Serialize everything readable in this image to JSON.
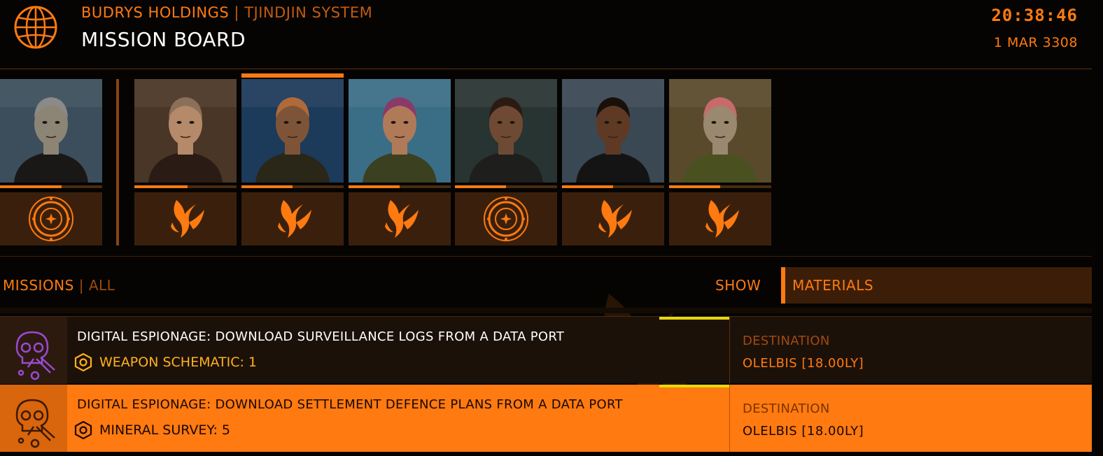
{
  "header": {
    "organisation": "BUDRYS HOLDINGS",
    "separator": "|",
    "system": "TJINDJIN SYSTEM",
    "title": "MISSION BOARD",
    "time": "20:38:46",
    "date": "1 MAR 3308"
  },
  "contacts": [
    {
      "faction_icon": "federation-emblem-icon",
      "reputation": 0.6,
      "selected": false,
      "skin": "#8c8474",
      "hair": "#8a8a88",
      "bg": "#3c4e5c",
      "coat": "#1a1816"
    },
    {
      "faction_icon": "phoenix-emblem-icon",
      "reputation": 0.52,
      "selected": false,
      "skin": "#b48a6a",
      "hair": "#8a7058",
      "bg": "#4a3626",
      "coat": "#2a1c14"
    },
    {
      "faction_icon": "phoenix-emblem-icon",
      "reputation": 0.5,
      "selected": true,
      "skin": "#7e5438",
      "hair": "#b06a3a",
      "bg": "#1c3a5a",
      "coat": "#2a2618"
    },
    {
      "faction_icon": "phoenix-emblem-icon",
      "reputation": 0.5,
      "selected": false,
      "skin": "#b07a58",
      "hair": "#8a3a6a",
      "bg": "#3a6e86",
      "coat": "#3a4020"
    },
    {
      "faction_icon": "federation-emblem-icon",
      "reputation": 0.5,
      "selected": false,
      "skin": "#6e4a34",
      "hair": "#2a1a12",
      "bg": "#283432",
      "coat": "#1e1e1c"
    },
    {
      "faction_icon": "phoenix-emblem-icon",
      "reputation": 0.5,
      "selected": false,
      "skin": "#5e3a24",
      "hair": "#1a100a",
      "bg": "#3a4854",
      "coat": "#141414"
    },
    {
      "faction_icon": "phoenix-emblem-icon",
      "reputation": 0.5,
      "selected": false,
      "skin": "#9a8870",
      "hair": "#c86a6a",
      "bg": "#5a4a2c",
      "coat": "#4a5020"
    }
  ],
  "filter": {
    "missions_label": "MISSIONS",
    "separator": "|",
    "scope": "ALL",
    "show_label": "SHOW",
    "show_value": "MATERIALS"
  },
  "missions": [
    {
      "title": "DIGITAL ESPIONAGE: DOWNLOAD SURVEILLANCE LOGS FROM A DATA PORT",
      "reward": "WEAPON SCHEMATIC: 1",
      "destination_label": "DESTINATION",
      "destination": "OLELBIS [18.00LY]",
      "icon": "skull-hacking-icon"
    },
    {
      "title": "DIGITAL ESPIONAGE: DOWNLOAD SETTLEMENT DEFENCE PLANS FROM A DATA PORT",
      "reward": "MINERAL SURVEY: 5",
      "destination_label": "DESTINATION",
      "destination": "OLELBIS [18.00LY]",
      "icon": "skull-hacking-icon"
    }
  ],
  "colors": {
    "accent": "#ff7a10",
    "reward_yellow": "#ffb21e",
    "hack_purple": "#9a4ad0",
    "selected_row": "#ff7a10"
  }
}
